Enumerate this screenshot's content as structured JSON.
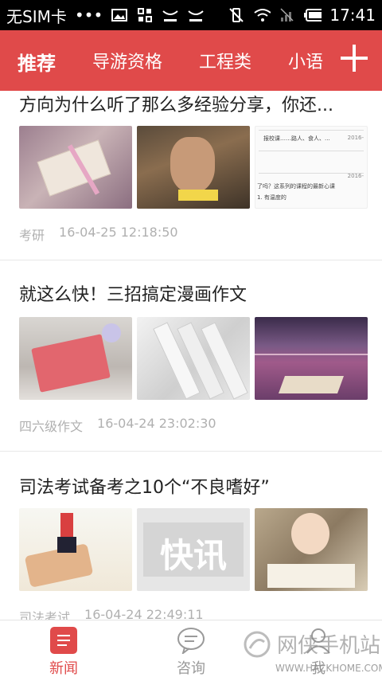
{
  "statusbar": {
    "carrier": "无SIM卡",
    "dots": "•••",
    "time": "17:41",
    "icons": [
      "image-icon",
      "apps-icon",
      "usb-icon",
      "usb-icon",
      "mute-icon",
      "wifi-icon",
      "signal-icon",
      "battery-icon"
    ]
  },
  "tabs": [
    {
      "label": "推荐",
      "active": true
    },
    {
      "label": "导游资格",
      "active": false
    },
    {
      "label": "工程类",
      "active": false
    },
    {
      "label": "小语",
      "active": false
    }
  ],
  "articles": [
    {
      "title": "方向为什么听了那么多经验分享，你还...",
      "category": "考研",
      "timestamp": "16-04-25 12:18:50",
      "thumb3_text": [
        "报校课……路人、食人、...",
        "2016-",
        "了吗？这系列的课程的最新心课",
        "1. 有温度的",
        "2016-"
      ]
    },
    {
      "title": "就这么快！三招搞定漫画作文",
      "category": "四六级作文",
      "timestamp": "16-04-24 23:02:30"
    },
    {
      "title": "司法考试备考之10个“不良嗜好”",
      "category": "司法考试",
      "timestamp": "16-04-24 22:49:11",
      "thumb2_text": "快讯"
    }
  ],
  "bottomnav": [
    {
      "label": "新闻",
      "active": true,
      "icon": "news-icon"
    },
    {
      "label": "咨询",
      "active": false,
      "icon": "chat-icon"
    },
    {
      "label": "我",
      "active": false,
      "icon": "user-icon"
    }
  ],
  "watermark": {
    "text": "网侠手机站",
    "url": "WWW.HACKHOME.COM"
  },
  "colors": {
    "accent": "#e04a4a",
    "meta": "#b0b0b0"
  }
}
